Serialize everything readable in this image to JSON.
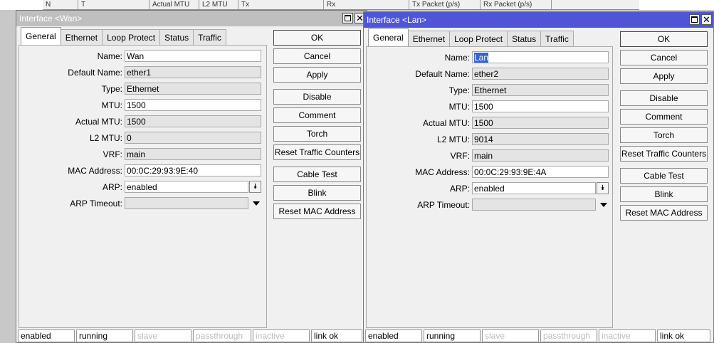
{
  "background": {
    "columns": [
      "N",
      "T",
      "Actual MTU",
      "L2 MTU",
      "Tx",
      "Rx",
      "Tx Packet (p/s)",
      "Rx Packet (p/s)"
    ]
  },
  "wan": {
    "title": "Interface <Wan>",
    "tabs": [
      "General",
      "Ethernet",
      "Loop Protect",
      "Status",
      "Traffic"
    ],
    "fields": {
      "name_label": "Name:",
      "name": "Wan",
      "default_name_label": "Default Name:",
      "default_name": "ether1",
      "type_label": "Type:",
      "type": "Ethernet",
      "mtu_label": "MTU:",
      "mtu": "1500",
      "actual_mtu_label": "Actual MTU:",
      "actual_mtu": "1500",
      "l2mtu_label": "L2 MTU:",
      "l2mtu": "0",
      "vrf_label": "VRF:",
      "vrf": "main",
      "mac_label": "MAC Address:",
      "mac": "00:0C:29:93:9E:40",
      "arp_label": "ARP:",
      "arp": "enabled",
      "arp_timeout_label": "ARP Timeout:",
      "arp_timeout": ""
    },
    "buttons": {
      "ok": "OK",
      "cancel": "Cancel",
      "apply": "Apply",
      "disable": "Disable",
      "comment": "Comment",
      "torch": "Torch",
      "reset_traffic": "Reset Traffic Counters",
      "cable_test": "Cable Test",
      "blink": "Blink",
      "reset_mac": "Reset MAC Address"
    },
    "status": [
      "enabled",
      "running",
      "slave",
      "passthrough",
      "inactive",
      "link ok"
    ]
  },
  "lan": {
    "title": "Interface <Lan>",
    "tabs": [
      "General",
      "Ethernet",
      "Loop Protect",
      "Status",
      "Traffic"
    ],
    "fields": {
      "name_label": "Name:",
      "name": "Lan",
      "default_name_label": "Default Name:",
      "default_name": "ether2",
      "type_label": "Type:",
      "type": "Ethernet",
      "mtu_label": "MTU:",
      "mtu": "1500",
      "actual_mtu_label": "Actual MTU:",
      "actual_mtu": "1500",
      "l2mtu_label": "L2 MTU:",
      "l2mtu": "9014",
      "vrf_label": "VRF:",
      "vrf": "main",
      "mac_label": "MAC Address:",
      "mac": "00:0C:29:93:9E:4A",
      "arp_label": "ARP:",
      "arp": "enabled",
      "arp_timeout_label": "ARP Timeout:",
      "arp_timeout": ""
    },
    "buttons": {
      "ok": "OK",
      "cancel": "Cancel",
      "apply": "Apply",
      "disable": "Disable",
      "comment": "Comment",
      "torch": "Torch",
      "reset_traffic": "Reset Traffic Counters",
      "cable_test": "Cable Test",
      "blink": "Blink",
      "reset_mac": "Reset MAC Address"
    },
    "status": [
      "enabled",
      "running",
      "slave",
      "passthrough",
      "inactive",
      "link ok"
    ]
  },
  "colors": {
    "active_title": "#4f56d6",
    "inactive_title": "#bfbfbf"
  }
}
